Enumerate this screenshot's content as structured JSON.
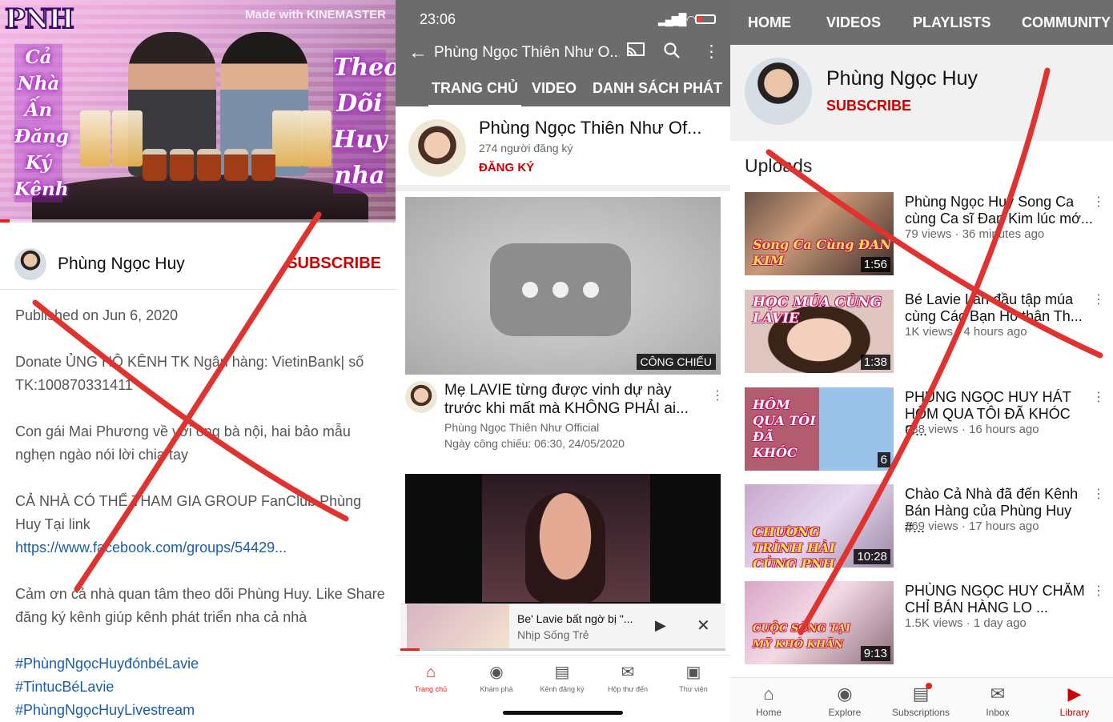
{
  "colors": {
    "accent_red": "#cc0000",
    "overlay_x": "#e0332f",
    "link_blue": "#1a5ea8",
    "top_bar_gray": "#6c6c6c"
  },
  "panel1": {
    "video": {
      "logo": "PNH",
      "watermark": "Made with KINEMASTER",
      "left_caption": [
        "Cả",
        "Nhà",
        "Ấn",
        "Đăng",
        "Ký",
        "Kênh"
      ],
      "right_caption": [
        "Theo",
        "Dõi",
        "Huy",
        "nha"
      ],
      "progress_fraction": 0.025
    },
    "channel": {
      "name": "Phùng Ngọc Huy",
      "subscribe": "SUBSCRIBE"
    },
    "description": {
      "published": "Published on Jun 6, 2020",
      "donate": "Donate ỦNG HỘ KÊNH TK Ngân hàng: VietinBank| số TK:100870331411",
      "line2": "Con gái Mai Phương về với ông bà nội, hai bảo mẫu nghẹn ngào nói lời chia tay",
      "line3": "CẢ NHÀ CÓ THỂ THAM GIA GROUP FanClub Phùng Huy Tại link",
      "link": "https://www.facebook.com/groups/54429...",
      "line4": "Cảm ơn cả nhà quan tâm theo dõi Phùng Huy. Like Share đăng ký kênh giúp kênh phát triển nha cả nhà",
      "tags": [
        "#PhùngNgọcHuyđónbéLavie",
        "#TintucBéLavie",
        "#PhùngNgọcHuyLivestream"
      ]
    }
  },
  "panel2": {
    "status_time": "23:06",
    "title": "Phùng Ngọc Thiên Như O...",
    "tabs": [
      "TRANG CHỦ",
      "VIDEO",
      "DANH SÁCH PHÁT"
    ],
    "channel": {
      "name": "Phùng Ngọc Thiên Như Of...",
      "subs": "274 người đăng ký",
      "subscribe": "ĐĂNG KÝ"
    },
    "premiere_badge": "CÔNG CHIẾU",
    "video1": {
      "title": "Mẹ LAVIE từng được vinh dự này trước khi mất mà KHÔNG PHẢI ai...",
      "channel": "Phùng Ngọc Thiên Như Official",
      "date": "Ngày công chiếu: 06:30, 24/05/2020"
    },
    "mini_player": {
      "title": "Be' Lavie bất ngờ bị \"...",
      "subtitle": "Nhịp Sống Trẻ"
    },
    "nav": [
      {
        "label": "Trang chủ",
        "icon": "home-icon"
      },
      {
        "label": "Khám phá",
        "icon": "explore-icon"
      },
      {
        "label": "Kênh đăng ký",
        "icon": "subscriptions-icon"
      },
      {
        "label": "Hộp thư đến",
        "icon": "inbox-icon"
      },
      {
        "label": "Thư viện",
        "icon": "library-icon"
      }
    ]
  },
  "panel3": {
    "tabs": [
      "HOME",
      "VIDEOS",
      "PLAYLISTS",
      "COMMUNITY"
    ],
    "channel": {
      "name": "Phùng Ngọc Huy",
      "subscribe": "SUBSCRIBE"
    },
    "uploads_label": "Uploads",
    "videos": [
      {
        "title": "Phùng Ngọc Huy Song Ca cùng Ca sĩ Đan Kim lúc mớ...",
        "meta": "79 views · 36 minutes ago",
        "duration": "1:56",
        "thumb_caption": "Song Ca Cùng ĐAN KIM"
      },
      {
        "title": "Bé Lavie Lần đầu tập múa cùng Các Bạn Hồ thân Th...",
        "meta": "1K views · 4 hours ago",
        "duration": "1:38",
        "thumb_caption": "HỌC MÚA CÙNG LAVIE"
      },
      {
        "title": "PHÙNG NGỌC HUY HÁT HÔM QUA TÔI ĐÃ KHÓC C...",
        "meta": "938 views · 16 hours ago",
        "duration": "6",
        "thumb_caption": "HÔM QUA TÔI ĐÃ KHÓC"
      },
      {
        "title": "Chào Cả Nhà đã đến Kênh Bán Hàng của Phùng Huy #...",
        "meta": "369 views · 17 hours ago",
        "duration": "10:28",
        "thumb_caption": "CHƯƠNG TRÌNH HÀI CÙNG PNH"
      },
      {
        "title": "PHÙNG NGỌC HUY CHĂM CHỈ BÁN HÀNG LO ...",
        "meta": "1.5K views · 1 day ago",
        "duration": "9:13",
        "thumb_caption": "CUỘC SỐNG TẠI MỸ KHÓ KHĂN"
      }
    ],
    "nav": [
      {
        "label": "Home",
        "icon": "home-icon"
      },
      {
        "label": "Explore",
        "icon": "explore-icon"
      },
      {
        "label": "Subscriptions",
        "icon": "subscriptions-icon"
      },
      {
        "label": "Inbox",
        "icon": "inbox-icon"
      },
      {
        "label": "Library",
        "icon": "library-icon"
      }
    ]
  }
}
